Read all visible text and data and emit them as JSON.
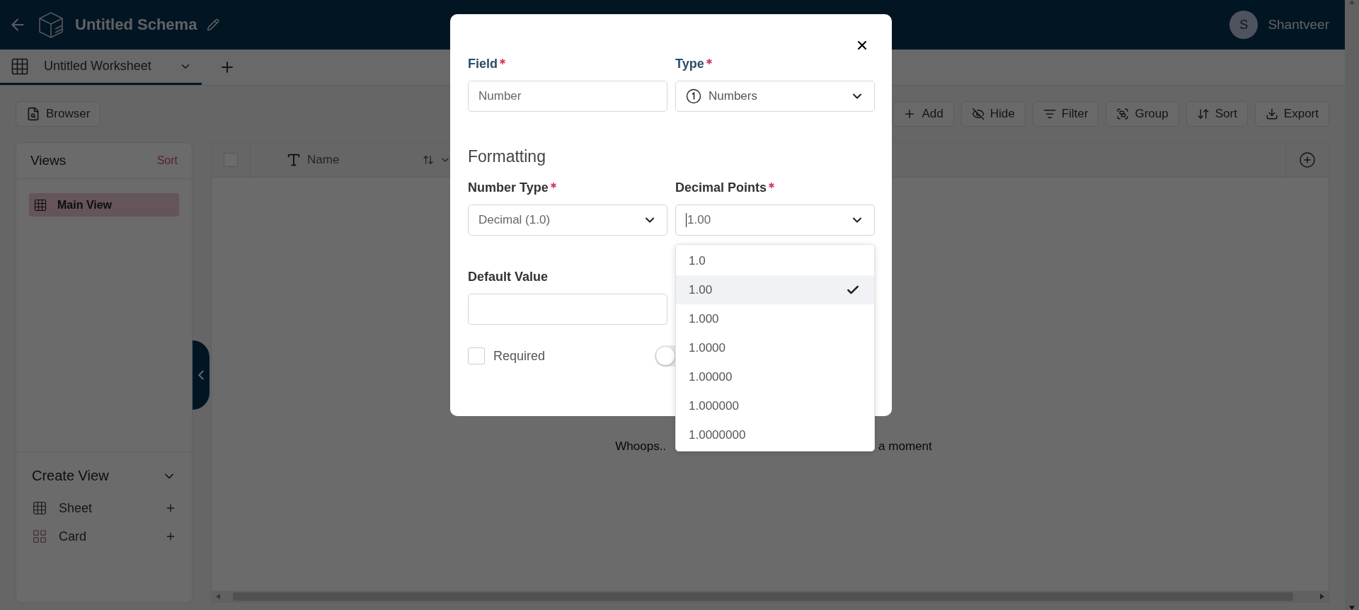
{
  "header": {
    "title": "Untitled Schema",
    "user": {
      "initial": "S",
      "name": "Shantveer"
    }
  },
  "worksheet_tabs": [
    {
      "label": "Untitled Worksheet",
      "selected": true
    }
  ],
  "toolbar": {
    "browser": "Browser",
    "actions": [
      {
        "kind": "add",
        "label": "Add"
      },
      {
        "kind": "hide",
        "label": "Hide"
      },
      {
        "kind": "filter",
        "label": "Filter"
      },
      {
        "kind": "group",
        "label": "Group"
      },
      {
        "kind": "sort",
        "label": "Sort"
      },
      {
        "kind": "export",
        "label": "Export"
      }
    ]
  },
  "views": {
    "title": "Views",
    "sort": "Sort",
    "items": [
      {
        "label": "Main View",
        "selected": true
      }
    ]
  },
  "create_view": {
    "title": "Create View",
    "items": [
      {
        "kind": "sheet",
        "label": "Sheet"
      },
      {
        "kind": "card",
        "label": "Card"
      }
    ]
  },
  "grid": {
    "select_all": {
      "checked": false
    },
    "columns": [
      {
        "label": "Name"
      }
    ],
    "empty_message": [
      "Whoops..",
      "a moment"
    ]
  },
  "dialog": {
    "field": {
      "label": "Field",
      "required": true,
      "value": "Number"
    },
    "type": {
      "label": "Type",
      "required": true,
      "value": "Numbers"
    },
    "heading": "Formatting",
    "number_type": {
      "label": "Number Type",
      "required": true,
      "value": "Decimal (1.0)"
    },
    "decimal_points": {
      "label": "Decimal Points",
      "required": true,
      "value": "1.00",
      "expanded": true,
      "options": [
        {
          "label": "1.0",
          "selected": false
        },
        {
          "label": "1.00",
          "selected": true
        },
        {
          "label": "1.000",
          "selected": false
        },
        {
          "label": "1.0000",
          "selected": false
        },
        {
          "label": "1.00000",
          "selected": false
        },
        {
          "label": "1.000000",
          "selected": false
        },
        {
          "label": "1.0000000",
          "selected": false
        }
      ]
    },
    "default_value": {
      "label": "Default Value",
      "required": false
    },
    "required_checkbox": {
      "label": "Required",
      "checked": false
    },
    "toggle": {
      "on": false
    }
  }
}
